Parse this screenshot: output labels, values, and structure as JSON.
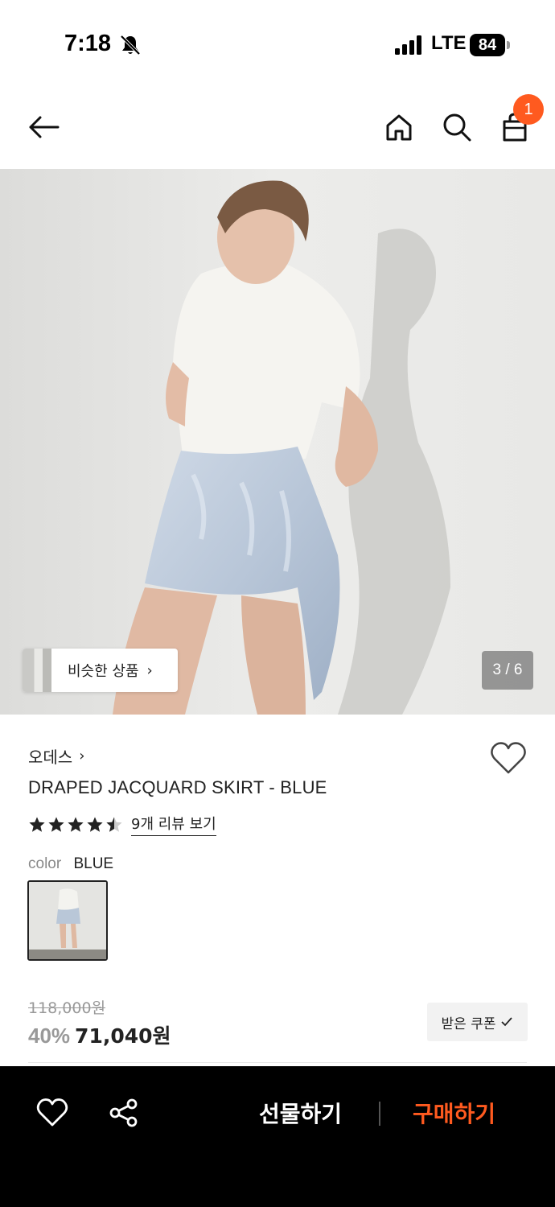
{
  "status_bar": {
    "time": "7:18",
    "network": "LTE",
    "battery": "84"
  },
  "header": {
    "cart_count": "1"
  },
  "gallery": {
    "similar_label": "비슷한 상품",
    "counter": "3 / 6"
  },
  "product": {
    "brand": "오데스",
    "title": "DRAPED JACQUARD SKIRT - BLUE",
    "rating_stars": 4.5,
    "review_link": "9개 리뷰 보기",
    "color_key": "color",
    "color_value": "BLUE",
    "original_price": "118,000원",
    "discount": "40%",
    "sale_price": "71,040원",
    "coupon_label": "받은 쿠폰"
  },
  "bottom_bar": {
    "gift_label": "선물하기",
    "buy_label": "구매하기"
  },
  "colors": {
    "accent": "#ff5a1f",
    "bottom_bar_bg": "#000000"
  }
}
